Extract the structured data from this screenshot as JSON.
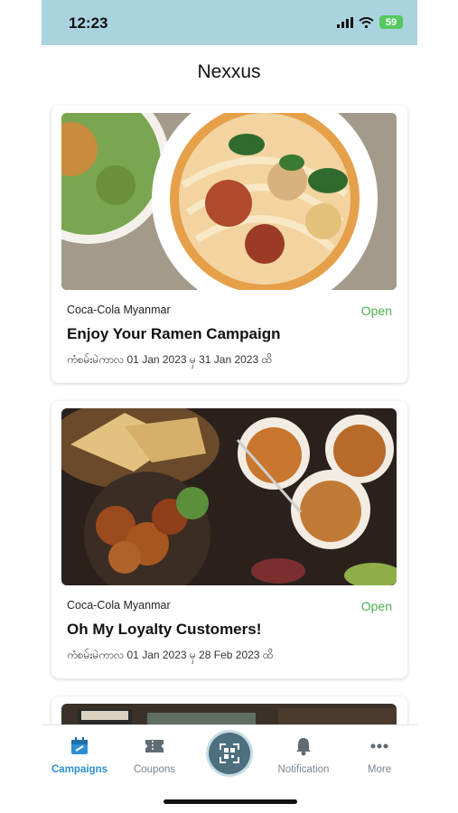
{
  "status_bar": {
    "time": "12:23",
    "battery": "59"
  },
  "header": {
    "title": "Nexxus"
  },
  "campaigns": [
    {
      "brand": "Coca-Cola Myanmar",
      "status": "Open",
      "title": "Enjoy Your Ramen Campaign",
      "period": "ကံစမ်းမဲကာလ 01 Jan 2023 မှ 31 Jan 2023 ထိ",
      "image": "ramen-noodle-bowl-photo"
    },
    {
      "brand": "Coca-Cola Myanmar",
      "status": "Open",
      "title": "Oh My Loyalty Customers!",
      "period": "ကံစမ်းမဲကာလ 01 Jan 2023 မှ 28 Feb 2023 ထိ",
      "image": "curry-and-naan-spread-photo"
    }
  ],
  "tabs": [
    {
      "label": "Campaigns",
      "icon": "calendar-icon",
      "active": true
    },
    {
      "label": "Coupons",
      "icon": "ticket-icon"
    },
    {
      "label": "",
      "icon": "qr-scan-icon"
    },
    {
      "label": "Notification",
      "icon": "bell-icon"
    },
    {
      "label": "More",
      "icon": "more-dots-icon"
    }
  ],
  "colors": {
    "status_bar": "#a9d3df",
    "accent": "#2e8fd0",
    "open_status": "#4caf50",
    "scan_button": "#4d6f7e"
  }
}
